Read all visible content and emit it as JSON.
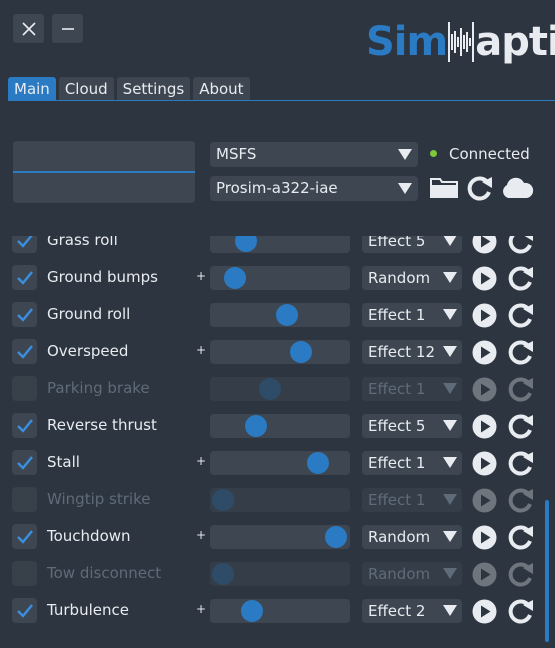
{
  "window": {
    "close_icon": "x-icon",
    "minimize_icon": "minus-icon"
  },
  "logo": {
    "part1": "Sim",
    "part2": "aptic"
  },
  "tabs": [
    {
      "label": "Main",
      "active": true
    },
    {
      "label": "Cloud",
      "active": false
    },
    {
      "label": "Settings",
      "active": false
    },
    {
      "label": "About",
      "active": false
    }
  ],
  "connection": {
    "simulator": "MSFS",
    "profile": "Prosim-a322-iae",
    "status": "Connected",
    "status_color": "#7ec93a"
  },
  "colors": {
    "accent": "#2a7bc4",
    "panel": "#3e4751",
    "background": "#2d3540"
  },
  "effects": [
    {
      "label": "Grass roll",
      "checked": true,
      "enabled": true,
      "plus": false,
      "level": 0.26,
      "effect": "Effect 5"
    },
    {
      "label": "Ground bumps",
      "checked": true,
      "enabled": true,
      "plus": true,
      "level": 0.18,
      "effect": "Random"
    },
    {
      "label": "Ground roll",
      "checked": true,
      "enabled": true,
      "plus": false,
      "level": 0.55,
      "effect": "Effect 1"
    },
    {
      "label": "Overspeed",
      "checked": true,
      "enabled": true,
      "plus": true,
      "level": 0.65,
      "effect": "Effect 12"
    },
    {
      "label": "Parking brake",
      "checked": false,
      "enabled": false,
      "plus": false,
      "level": 0.43,
      "effect": "Effect 1"
    },
    {
      "label": "Reverse thrust",
      "checked": true,
      "enabled": true,
      "plus": false,
      "level": 0.33,
      "effect": "Effect 5"
    },
    {
      "label": "Stall",
      "checked": true,
      "enabled": true,
      "plus": true,
      "level": 0.77,
      "effect": "Effect 1"
    },
    {
      "label": "Wingtip strike",
      "checked": false,
      "enabled": false,
      "plus": false,
      "level": 0.09,
      "effect": "Effect 1"
    },
    {
      "label": "Touchdown",
      "checked": true,
      "enabled": true,
      "plus": true,
      "level": 0.9,
      "effect": "Random"
    },
    {
      "label": "Tow disconnect",
      "checked": false,
      "enabled": false,
      "plus": false,
      "level": 0.09,
      "effect": "Random"
    },
    {
      "label": "Turbulence",
      "checked": true,
      "enabled": true,
      "plus": true,
      "level": 0.3,
      "effect": "Effect 2"
    }
  ],
  "plus_label": "+"
}
